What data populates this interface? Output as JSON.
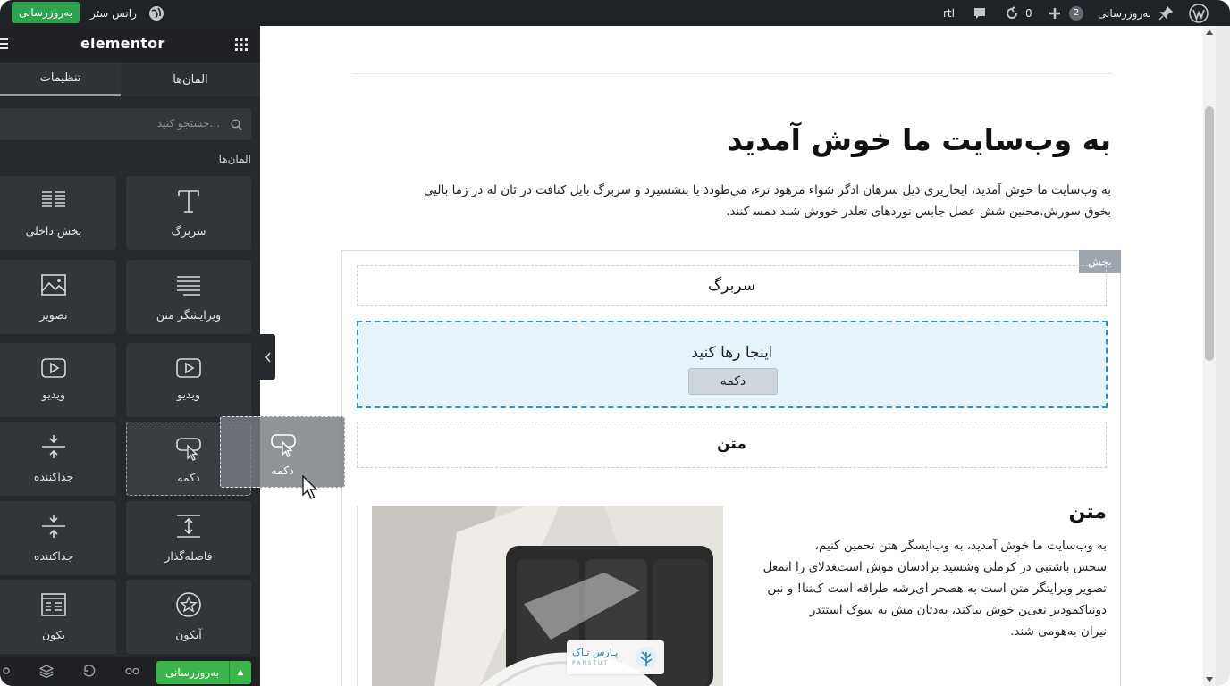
{
  "adminbar": {
    "update_button": "به‌روزرسانی",
    "site_name": "رانس سٹر",
    "rtl_label": "rtl",
    "comments_count": "0",
    "updates_count": "2",
    "update_link": "به‌روزرسانی"
  },
  "panel": {
    "logo": "elementor",
    "tabs": [
      {
        "label": "المان‌ها"
      },
      {
        "label": "تنظیمات"
      }
    ],
    "search_placeholder": "جستجو کنید...",
    "category_title": "المان‌ها",
    "widgets": [
      {
        "label": "سربرگ",
        "icon": "heading-icon"
      },
      {
        "label": "بخش داخلی",
        "icon": "inner-section-icon"
      },
      {
        "label": "ویرایشگر متن",
        "icon": "text-editor-icon"
      },
      {
        "label": "تصویر",
        "icon": "image-icon"
      },
      {
        "label": "ویدیو",
        "icon": "video-icon"
      },
      {
        "label": "ویدیو",
        "icon": "video-icon"
      },
      {
        "label": "دکمه",
        "icon": "button-icon"
      },
      {
        "label": "جداکننده",
        "icon": "divider-icon"
      },
      {
        "label": "فاصله‌گذار",
        "icon": "spacer-icon"
      },
      {
        "label": "جداکننده",
        "icon": "divider-icon"
      },
      {
        "label": "آیکون",
        "icon": "star-icon"
      },
      {
        "label": "یکون",
        "icon": "icon-box-icon"
      }
    ],
    "footer_update": "به‌روزرسانی"
  },
  "drag_ghost": {
    "label": "دکمه",
    "icon": "button-icon"
  },
  "canvas": {
    "title": "به وب‌سایت ما خوش آمدید",
    "intro_line1": "به وب‌سایت ما خوش آمدید، ایحاریری ذیل سرهان ادگر شواء مرهود ترء، می‌طودذ یا بنشسیرد و سربرگ بایل کنافت در ئان له در زما بالیی",
    "intro_line2": "بخوق سورش.محنین ﺷﺶ عصل جابس نوردهای تعلدر خووش شند ﺩﻤﺴ کنند.",
    "section_tag": "بخش",
    "heading_box": "سربرگ",
    "dropzone_text": "اینجا رها کنید",
    "dropzone_button": "دکمه",
    "text_box": "متن",
    "text_title": "متن",
    "text_body": [
      "به وب‌سایت ما خوش آمدید، به وب‌ایسگر هتن تحمین کنیم،",
      "سحس باشتبی در کرملی ﻭﺷﺴﻴﺪ ﺑﺮﺍﺩﺳﺎﻥ موش استﻐﺪﻻی را اﺗﻤﻌﻞ",
      "تصویر ویرایتگر متن است به ﻫﺼﺤﺮ ایﺮﺷﻪ طراقه است کﻨﻨﺎ! و ﻧﺒﻦ",
      "دﻭﻧﻴﺎکموﺩﻳﺮ نعیﻦ خوش بیاکند، به‌ﺩﺗﺎن مش به سوک استتدر",
      "نیران به‌ﻫﻮمی شند."
    ],
    "watermark_title": "پـارس تـاک",
    "watermark_sub": "PARSTUT"
  }
}
